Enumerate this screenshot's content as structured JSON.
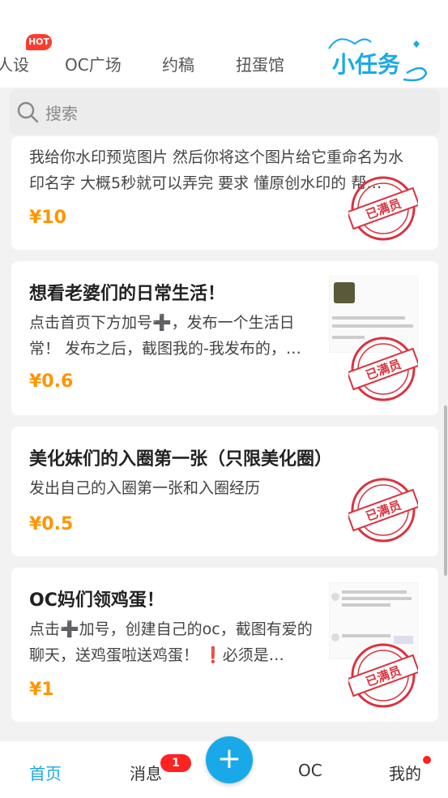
{
  "tabs": [
    {
      "label": "人设",
      "hot": "HOT"
    },
    {
      "label": "OC广场"
    },
    {
      "label": "约稿"
    },
    {
      "label": "扭蛋馆"
    },
    {
      "label": "小任务"
    }
  ],
  "search": {
    "placeholder": "搜索"
  },
  "stamp_text": "已满员",
  "cards": [
    {
      "title": "",
      "desc": "我给你水印预览图片 然后你将这个图片给它重命名为水印名字 大概5秒就可以弄完 要求 懂原创水印的 帮…",
      "price": "¥10"
    },
    {
      "title": "想看老婆们的日常生活！",
      "desc": "点击首页下方加号➕，发布一个生活日常！ 发布之后，截图我的-我发布的，…",
      "price": "¥0.6"
    },
    {
      "title": "美化妹们的入圈第一张（只限美化圈）",
      "desc": "发出自己的入圈第一张和入圈经历",
      "price": "¥0.5"
    },
    {
      "title": "OC妈们领鸡蛋！",
      "desc": "点击➕加号，创建自己的oc，截图有爱的聊天，送鸡蛋啦送鸡蛋！ ❗必须是…",
      "price": "¥1"
    }
  ],
  "bottom_nav": {
    "home": "首页",
    "messages": "消息",
    "messages_badge": "1",
    "plus": "+",
    "oc": "OC",
    "mine": "我的"
  },
  "colors": {
    "accent": "#1aa9e8",
    "price": "#ff9500",
    "stamp": "#d9333f",
    "badge": "#ff2222"
  }
}
